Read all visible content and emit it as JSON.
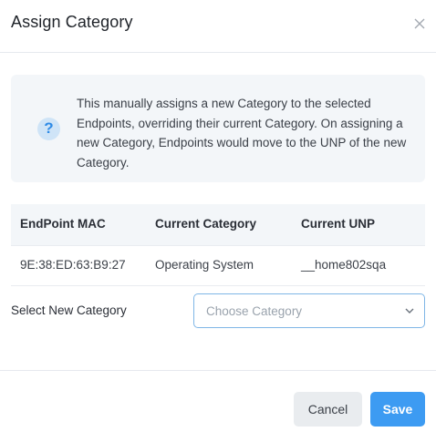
{
  "dialog": {
    "title": "Assign Category"
  },
  "info": {
    "icon": "question-icon",
    "glyph": "?",
    "text": "This manually assigns a new Category to the selected Endpoints, overriding their current Category. On assigning a new Category, Endpoints would move to the UNP of the new Category."
  },
  "table": {
    "headers": [
      "EndPoint MAC",
      "Current Category",
      "Current UNP"
    ],
    "rows": [
      [
        "9E:38:ED:63:B9:27",
        "Operating System",
        "__home802sqa"
      ]
    ]
  },
  "form": {
    "label": "Select New Category",
    "placeholder": "Choose Category"
  },
  "footer": {
    "cancel_label": "Cancel",
    "save_label": "Save"
  },
  "colors": {
    "primary": "#3d9bf2",
    "info_bg": "#f3f6f9"
  }
}
